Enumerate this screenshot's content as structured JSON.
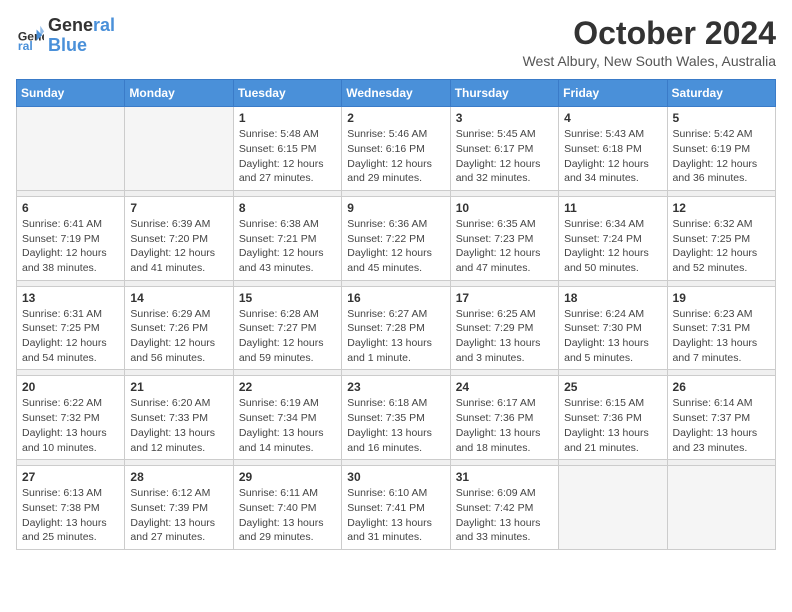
{
  "logo": {
    "text_general": "General",
    "text_blue": "Blue"
  },
  "title": "October 2024",
  "subtitle": "West Albury, New South Wales, Australia",
  "headers": [
    "Sunday",
    "Monday",
    "Tuesday",
    "Wednesday",
    "Thursday",
    "Friday",
    "Saturday"
  ],
  "weeks": [
    [
      {
        "day": "",
        "info": ""
      },
      {
        "day": "",
        "info": ""
      },
      {
        "day": "1",
        "info": "Sunrise: 5:48 AM\nSunset: 6:15 PM\nDaylight: 12 hours\nand 27 minutes."
      },
      {
        "day": "2",
        "info": "Sunrise: 5:46 AM\nSunset: 6:16 PM\nDaylight: 12 hours\nand 29 minutes."
      },
      {
        "day": "3",
        "info": "Sunrise: 5:45 AM\nSunset: 6:17 PM\nDaylight: 12 hours\nand 32 minutes."
      },
      {
        "day": "4",
        "info": "Sunrise: 5:43 AM\nSunset: 6:18 PM\nDaylight: 12 hours\nand 34 minutes."
      },
      {
        "day": "5",
        "info": "Sunrise: 5:42 AM\nSunset: 6:19 PM\nDaylight: 12 hours\nand 36 minutes."
      }
    ],
    [
      {
        "day": "6",
        "info": "Sunrise: 6:41 AM\nSunset: 7:19 PM\nDaylight: 12 hours\nand 38 minutes."
      },
      {
        "day": "7",
        "info": "Sunrise: 6:39 AM\nSunset: 7:20 PM\nDaylight: 12 hours\nand 41 minutes."
      },
      {
        "day": "8",
        "info": "Sunrise: 6:38 AM\nSunset: 7:21 PM\nDaylight: 12 hours\nand 43 minutes."
      },
      {
        "day": "9",
        "info": "Sunrise: 6:36 AM\nSunset: 7:22 PM\nDaylight: 12 hours\nand 45 minutes."
      },
      {
        "day": "10",
        "info": "Sunrise: 6:35 AM\nSunset: 7:23 PM\nDaylight: 12 hours\nand 47 minutes."
      },
      {
        "day": "11",
        "info": "Sunrise: 6:34 AM\nSunset: 7:24 PM\nDaylight: 12 hours\nand 50 minutes."
      },
      {
        "day": "12",
        "info": "Sunrise: 6:32 AM\nSunset: 7:25 PM\nDaylight: 12 hours\nand 52 minutes."
      }
    ],
    [
      {
        "day": "13",
        "info": "Sunrise: 6:31 AM\nSunset: 7:25 PM\nDaylight: 12 hours\nand 54 minutes."
      },
      {
        "day": "14",
        "info": "Sunrise: 6:29 AM\nSunset: 7:26 PM\nDaylight: 12 hours\nand 56 minutes."
      },
      {
        "day": "15",
        "info": "Sunrise: 6:28 AM\nSunset: 7:27 PM\nDaylight: 12 hours\nand 59 minutes."
      },
      {
        "day": "16",
        "info": "Sunrise: 6:27 AM\nSunset: 7:28 PM\nDaylight: 13 hours\nand 1 minute."
      },
      {
        "day": "17",
        "info": "Sunrise: 6:25 AM\nSunset: 7:29 PM\nDaylight: 13 hours\nand 3 minutes."
      },
      {
        "day": "18",
        "info": "Sunrise: 6:24 AM\nSunset: 7:30 PM\nDaylight: 13 hours\nand 5 minutes."
      },
      {
        "day": "19",
        "info": "Sunrise: 6:23 AM\nSunset: 7:31 PM\nDaylight: 13 hours\nand 7 minutes."
      }
    ],
    [
      {
        "day": "20",
        "info": "Sunrise: 6:22 AM\nSunset: 7:32 PM\nDaylight: 13 hours\nand 10 minutes."
      },
      {
        "day": "21",
        "info": "Sunrise: 6:20 AM\nSunset: 7:33 PM\nDaylight: 13 hours\nand 12 minutes."
      },
      {
        "day": "22",
        "info": "Sunrise: 6:19 AM\nSunset: 7:34 PM\nDaylight: 13 hours\nand 14 minutes."
      },
      {
        "day": "23",
        "info": "Sunrise: 6:18 AM\nSunset: 7:35 PM\nDaylight: 13 hours\nand 16 minutes."
      },
      {
        "day": "24",
        "info": "Sunrise: 6:17 AM\nSunset: 7:36 PM\nDaylight: 13 hours\nand 18 minutes."
      },
      {
        "day": "25",
        "info": "Sunrise: 6:15 AM\nSunset: 7:36 PM\nDaylight: 13 hours\nand 21 minutes."
      },
      {
        "day": "26",
        "info": "Sunrise: 6:14 AM\nSunset: 7:37 PM\nDaylight: 13 hours\nand 23 minutes."
      }
    ],
    [
      {
        "day": "27",
        "info": "Sunrise: 6:13 AM\nSunset: 7:38 PM\nDaylight: 13 hours\nand 25 minutes."
      },
      {
        "day": "28",
        "info": "Sunrise: 6:12 AM\nSunset: 7:39 PM\nDaylight: 13 hours\nand 27 minutes."
      },
      {
        "day": "29",
        "info": "Sunrise: 6:11 AM\nSunset: 7:40 PM\nDaylight: 13 hours\nand 29 minutes."
      },
      {
        "day": "30",
        "info": "Sunrise: 6:10 AM\nSunset: 7:41 PM\nDaylight: 13 hours\nand 31 minutes."
      },
      {
        "day": "31",
        "info": "Sunrise: 6:09 AM\nSunset: 7:42 PM\nDaylight: 13 hours\nand 33 minutes."
      },
      {
        "day": "",
        "info": ""
      },
      {
        "day": "",
        "info": ""
      }
    ]
  ]
}
